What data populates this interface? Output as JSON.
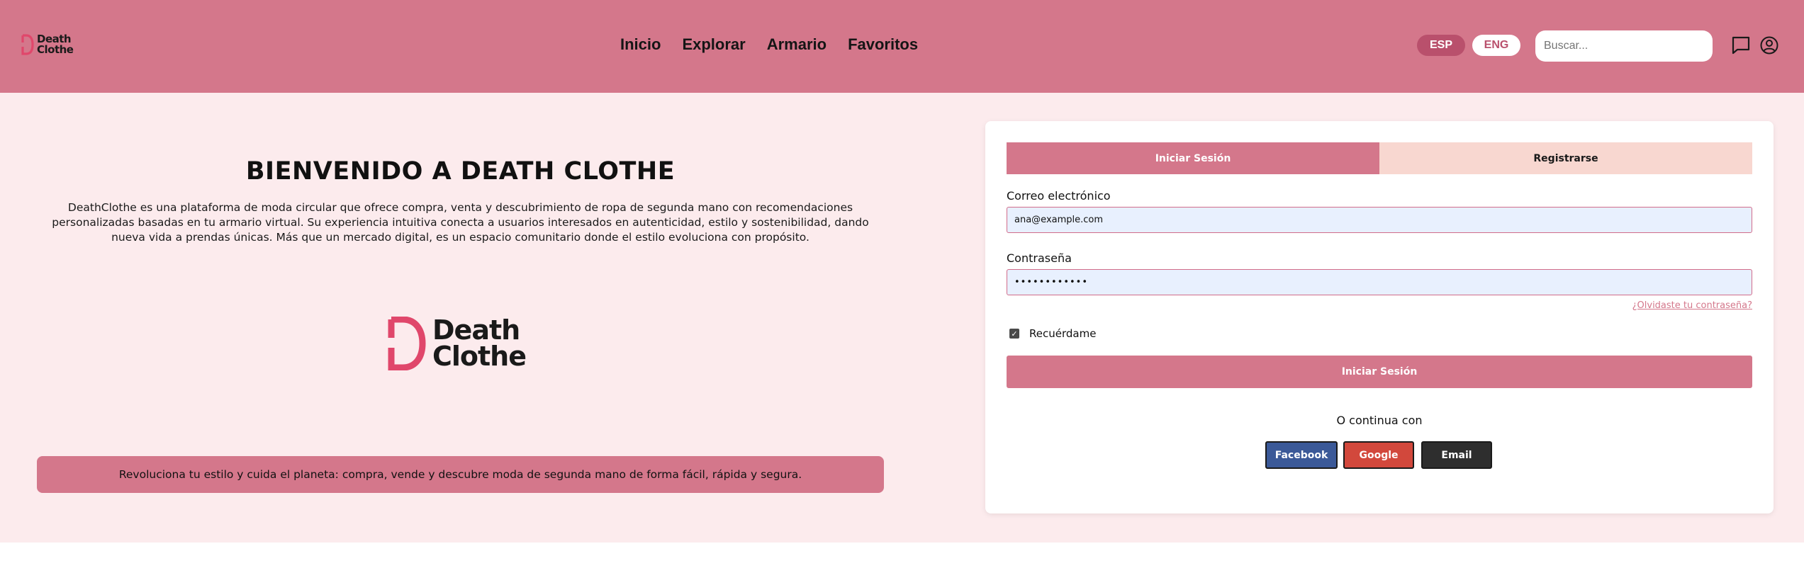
{
  "brand": {
    "name_line1": "Death",
    "name_line2": "Clothe",
    "color_primary": "#d4778b",
    "color_dark": "#b9506c",
    "logo_mark_color": "#e0476b"
  },
  "header": {
    "nav": [
      "Inicio",
      "Explorar",
      "Armario",
      "Favoritos"
    ],
    "lang_esp": "ESP",
    "lang_eng": "ENG",
    "active_lang": "ESP",
    "search_placeholder": "Buscar...",
    "icons": [
      "chat-icon",
      "user-icon"
    ]
  },
  "welcome": {
    "title": "BIENVENIDO A DEATH CLOTHE",
    "description": "DeathClothe es una plataforma de moda circular que ofrece compra, venta y descubrimiento de ropa de segunda mano con recomendaciones personalizadas basadas en tu armario virtual. Su experiencia intuitiva conecta a usuarios interesados en autenticidad, estilo y sostenibilidad, dando nueva vida a prendas únicas. Más que un mercado digital, es un espacio comunitario donde el estilo evoluciona con propósito.",
    "banner": "Revoluciona tu estilo y cuida el planeta: compra, vende y descubre moda de segunda mano de forma fácil, rápida y segura."
  },
  "login": {
    "tab_login": "Iniciar Sesión",
    "tab_register": "Registrarse",
    "active_tab": "Iniciar Sesión",
    "email_label": "Correo electrónico",
    "email_value": "ana@example.com",
    "password_label": "Contraseña",
    "password_value": "••••••••••••",
    "forgot": "¿Olvidaste tu contraseña?",
    "remember_label": "Recuérdame",
    "remember_checked": true,
    "submit": "Iniciar Sesión",
    "or_text": "O continua con",
    "social": {
      "facebook": "Facebook",
      "google": "Google",
      "email": "Email"
    }
  }
}
